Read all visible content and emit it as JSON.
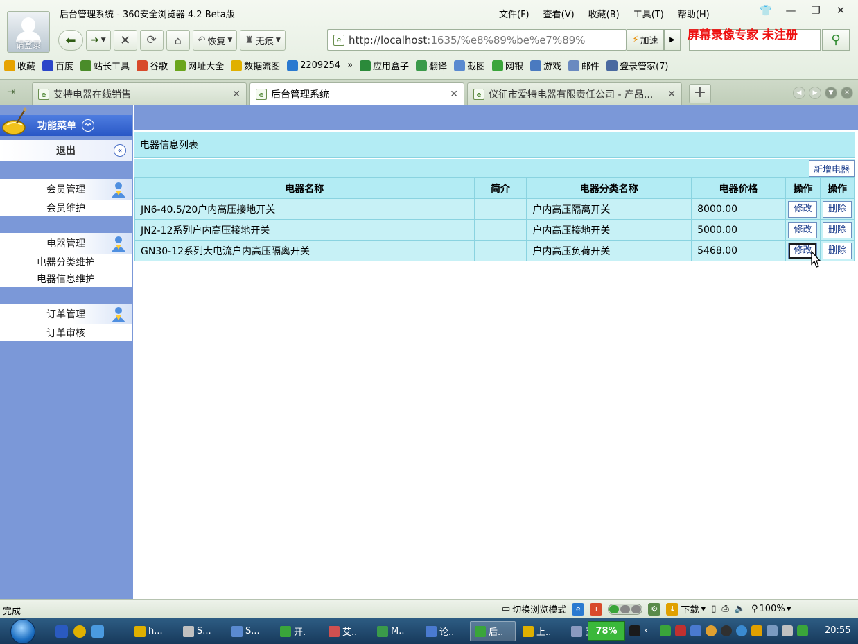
{
  "window": {
    "title": "后台管理系统 - 360安全浏览器 4.2 Beta版",
    "avatar_label": "请登录",
    "menu": [
      "文件(F)",
      "查看(V)",
      "收藏(B)",
      "工具(T)",
      "帮助(H)"
    ]
  },
  "toolbar": {
    "restore_label": "恢复",
    "notrace_label": "无痕",
    "address_host": "http://localhost",
    "address_rest": ":1635/%e8%89%be%e7%89%",
    "accelerate_label": "加速",
    "watermark": "屏幕录像专家  未注册"
  },
  "bookmarks": [
    {
      "label": "收藏",
      "icon": "star-icon",
      "color": "#e6a300"
    },
    {
      "label": "百度",
      "icon": "baidu-paw-icon",
      "color": "#2b46c9"
    },
    {
      "label": "站长工具",
      "icon": "page-icon",
      "color": "#4a8c2a"
    },
    {
      "label": "谷歌",
      "icon": "google-icon",
      "color": "#d84a2a"
    },
    {
      "label": "网址大全",
      "icon": "plus-circle-icon",
      "color": "#6aa51c"
    },
    {
      "label": "数据流图",
      "icon": "folder-icon",
      "color": "#e0b000"
    },
    {
      "label": "2209254",
      "icon": "globe-icon",
      "color": "#2a7ad0"
    },
    {
      "label": "»",
      "icon": "",
      "color": ""
    },
    {
      "label": "应用盒子",
      "icon": "box-icon",
      "color": "#2b8a3a"
    },
    {
      "label": "翻译",
      "icon": "translate-icon",
      "color": "#3a9a4a"
    },
    {
      "label": "截图",
      "icon": "screenshot-icon",
      "color": "#5a8ad0"
    },
    {
      "label": "网银",
      "icon": "bank-icon",
      "color": "#3aa53a"
    },
    {
      "label": "游戏",
      "icon": "gamepad-icon",
      "color": "#4a7ac0"
    },
    {
      "label": "邮件",
      "icon": "mail-icon",
      "color": "#6a8ac0"
    },
    {
      "label": "登录管家(7)",
      "icon": "key-icon",
      "color": "#4a6aa0"
    }
  ],
  "tabs": [
    {
      "label": "艾特电器在线销售",
      "active": false
    },
    {
      "label": "后台管理系统",
      "active": true
    },
    {
      "label": "仪征市爱特电器有限责任公司 - 产品...",
      "active": false
    }
  ],
  "sidebar": {
    "header": "功能菜单",
    "exit": "退出",
    "groups": [
      {
        "title": "会员管理",
        "items": [
          "会员维护"
        ]
      },
      {
        "title": "电器管理",
        "items": [
          "电器分类维护",
          "电器信息维护"
        ]
      },
      {
        "title": "订单管理",
        "items": [
          "订单审核"
        ]
      }
    ]
  },
  "main": {
    "list_title": "电器信息列表",
    "add_button": "新增电器",
    "columns": [
      "电器名称",
      "简介",
      "电器分类名称",
      "电器价格",
      "操作",
      "操作"
    ],
    "edit_label": "修改",
    "delete_label": "删除",
    "rows": [
      {
        "name": "JN6-40.5/20户内高压接地开关",
        "intro": "",
        "category": "户内高压隔离开关",
        "price": "8000.00"
      },
      {
        "name": "JN2-12系列户内高压接地开关",
        "intro": "",
        "category": "户内高压接地开关",
        "price": "5000.00"
      },
      {
        "name": "GN30-12系列大电流户内高压隔离开关",
        "intro": "",
        "category": "户内高压负荷开关",
        "price": "5468.00"
      }
    ]
  },
  "statusbar": {
    "status": "完成",
    "mode_switch": "切换浏览模式",
    "download": "下载",
    "zoom": "100%"
  },
  "taskbar": {
    "tasks": [
      "h...",
      "S...",
      "S...",
      "开.",
      "艾..",
      "M..",
      "论..",
      "后..",
      "上..",
      "图"
    ],
    "battery": "78%",
    "clock": "20:55"
  }
}
